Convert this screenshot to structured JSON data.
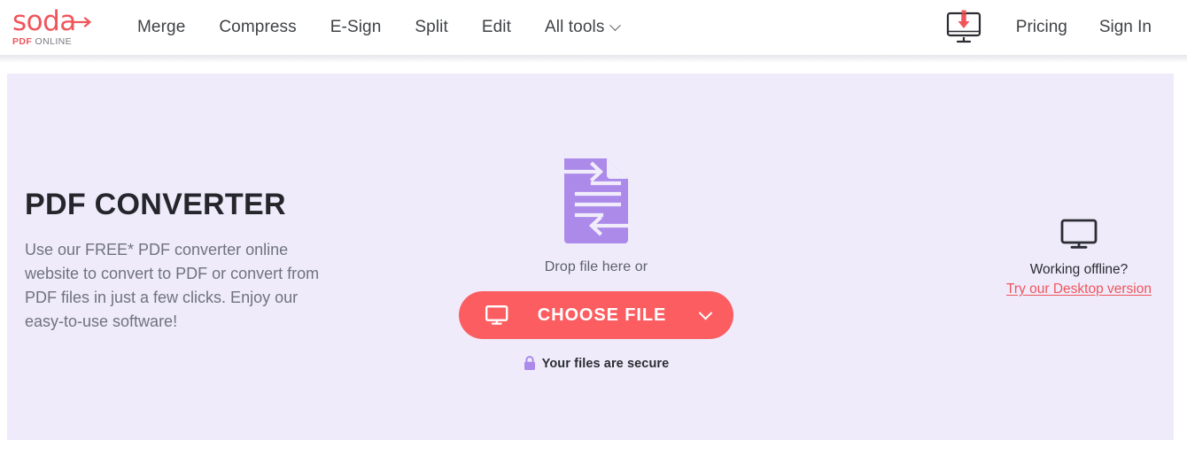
{
  "brand": {
    "logo_word": "soda",
    "logo_sub_pdf": "PDF",
    "logo_sub_online": "ONLINE",
    "accent_color": "#f0555c"
  },
  "header": {
    "nav": [
      {
        "label": "Merge",
        "icon": ""
      },
      {
        "label": "Compress",
        "icon": ""
      },
      {
        "label": "E-Sign",
        "icon": ""
      },
      {
        "label": "Split",
        "icon": ""
      },
      {
        "label": "Edit",
        "icon": ""
      },
      {
        "label": "All tools",
        "icon": "chevron-down-icon"
      }
    ],
    "desktop_icon": "monitor-download-icon",
    "pricing_label": "Pricing",
    "signin_label": "Sign In"
  },
  "hero": {
    "background_color": "#efebfa",
    "title": "PDF CONVERTER",
    "description": "Use our FREE* PDF converter online website to convert to PDF or convert from PDF files in just a few clicks. Enjoy our easy-to-use software!",
    "upload": {
      "file_icon": "pdf-convert-document-icon",
      "file_icon_color": "#ab8aea",
      "drop_text": "Drop file here or",
      "button_label": "CHOOSE FILE",
      "button_icon": "monitor-icon",
      "button_chevron": "chevron-down-icon",
      "button_color": "#fb5d61",
      "secure_icon": "lock-icon",
      "secure_text": "Your files are secure"
    },
    "offline": {
      "icon": "monitor-icon",
      "label": "Working offline?",
      "link_label": "Try our Desktop version"
    }
  }
}
